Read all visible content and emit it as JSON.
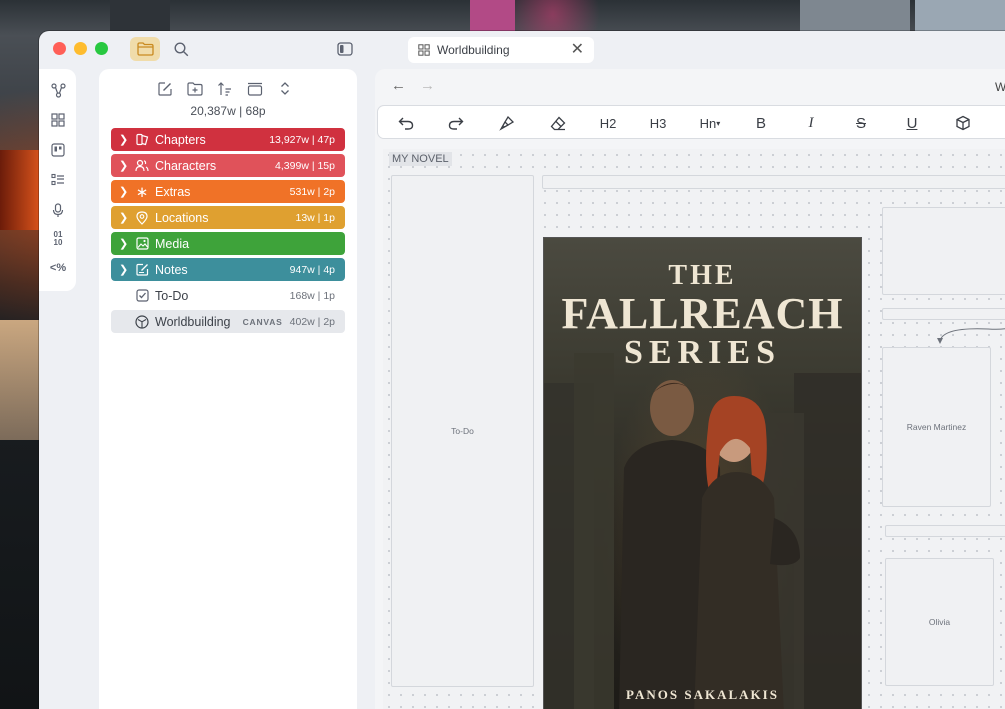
{
  "window": {
    "tab": {
      "label": "Worldbuilding",
      "icon": "canvas-grid-icon"
    },
    "edge_crumb": "W"
  },
  "rail": {
    "items": [
      {
        "icon": "graph-icon"
      },
      {
        "icon": "grid-icon"
      },
      {
        "icon": "board-icon"
      },
      {
        "icon": "outline-list-icon"
      },
      {
        "icon": "microphone-icon"
      },
      {
        "text": "01\n10"
      },
      {
        "text": "<%"
      }
    ]
  },
  "binder": {
    "stats": "20,387w | 68p",
    "items": [
      {
        "label": "Chapters",
        "stat": "13,927w | 47p",
        "color": "#d0313f",
        "icon": "book-icon"
      },
      {
        "label": "Characters",
        "stat": "4,399w | 15p",
        "color": "#e0525a",
        "icon": "people-icon"
      },
      {
        "label": "Extras",
        "stat": "531w | 2p",
        "color": "#f07227",
        "icon": "asterisk-icon"
      },
      {
        "label": "Locations",
        "stat": "13w | 1p",
        "color": "#dfa030",
        "icon": "pin-icon"
      },
      {
        "label": "Media",
        "stat": "",
        "color": "#3ea33a",
        "icon": "image-icon"
      },
      {
        "label": "Notes",
        "stat": "947w | 4p",
        "color": "#3d8f9c",
        "icon": "note-icon"
      },
      {
        "label": "To-Do",
        "stat": "168w | 1p",
        "icon": "checkbox-icon"
      },
      {
        "label": "Worldbuilding",
        "tag": "CANVAS",
        "stat": "402w | 2p",
        "icon": "cube-icon"
      }
    ]
  },
  "toolbar": {
    "h2": "H2",
    "h3": "H3",
    "hn": "Hn",
    "bold": "B",
    "italic": "I",
    "strike": "S",
    "underline": "U"
  },
  "canvas": {
    "group_label": "MY NOVEL",
    "cards": {
      "todo": "To-Do",
      "raven": "Raven Martinez",
      "olivia": "Olivia"
    },
    "cover": {
      "title_top": "THE",
      "title_main": "FALLREACH",
      "title_bottom": "SERIES",
      "author": "PANOS SAKALAKIS"
    }
  }
}
